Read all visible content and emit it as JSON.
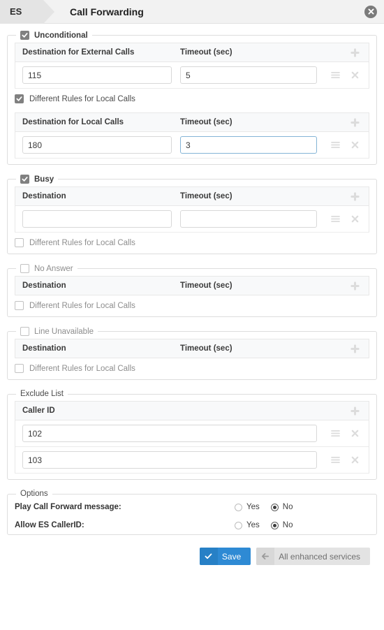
{
  "header": {
    "breadcrumb": "ES",
    "title": "Call Forwarding",
    "close_icon": "close-circle-icon"
  },
  "colors": {
    "accent": "#2e8ad4",
    "accent_dark": "#2780c6",
    "checkbox_on": "#808080",
    "focus_border": "#84b4d6",
    "header_bg": "#f2f2f2",
    "table_head_bg": "#f8f9fa"
  },
  "sections": {
    "unconditional": {
      "legend": "Unconditional",
      "checked": true,
      "external": {
        "col_destination": "Destination for External Calls",
        "col_timeout": "Timeout (sec)",
        "rows": [
          {
            "destination": "115",
            "timeout": "5",
            "timeout_focused": false
          }
        ]
      },
      "different_rules": {
        "label": "Different Rules for Local Calls",
        "checked": true
      },
      "local": {
        "col_destination": "Destination for Local Calls",
        "col_timeout": "Timeout (sec)",
        "rows": [
          {
            "destination": "180",
            "timeout": "3",
            "timeout_focused": true
          }
        ]
      }
    },
    "busy": {
      "legend": "Busy",
      "checked": true,
      "col_destination": "Destination",
      "col_timeout": "Timeout (sec)",
      "rows": [
        {
          "destination": "",
          "timeout": "",
          "timeout_focused": false
        }
      ],
      "different_rules": {
        "label": "Different Rules for Local Calls",
        "checked": false
      }
    },
    "no_answer": {
      "legend": "No Answer",
      "checked": false,
      "col_destination": "Destination",
      "col_timeout": "Timeout (sec)",
      "rows": [],
      "different_rules": {
        "label": "Different Rules for Local Calls",
        "checked": false
      }
    },
    "line_unavailable": {
      "legend": "Line Unavailable",
      "checked": false,
      "col_destination": "Destination",
      "col_timeout": "Timeout (sec)",
      "rows": [],
      "different_rules": {
        "label": "Different Rules for Local Calls",
        "checked": false
      }
    },
    "exclude_list": {
      "legend": "Exclude List",
      "col_caller_id": "Caller ID",
      "rows": [
        {
          "caller_id": "102"
        },
        {
          "caller_id": "103"
        }
      ]
    },
    "options": {
      "legend": "Options",
      "rows": [
        {
          "label": "Play Call Forward message:",
          "yes_label": "Yes",
          "no_label": "No",
          "value": "No"
        },
        {
          "label": "Allow ES CallerID:",
          "yes_label": "Yes",
          "no_label": "No",
          "value": "No"
        }
      ]
    }
  },
  "footer": {
    "save_label": "Save",
    "back_label": "All enhanced services"
  }
}
